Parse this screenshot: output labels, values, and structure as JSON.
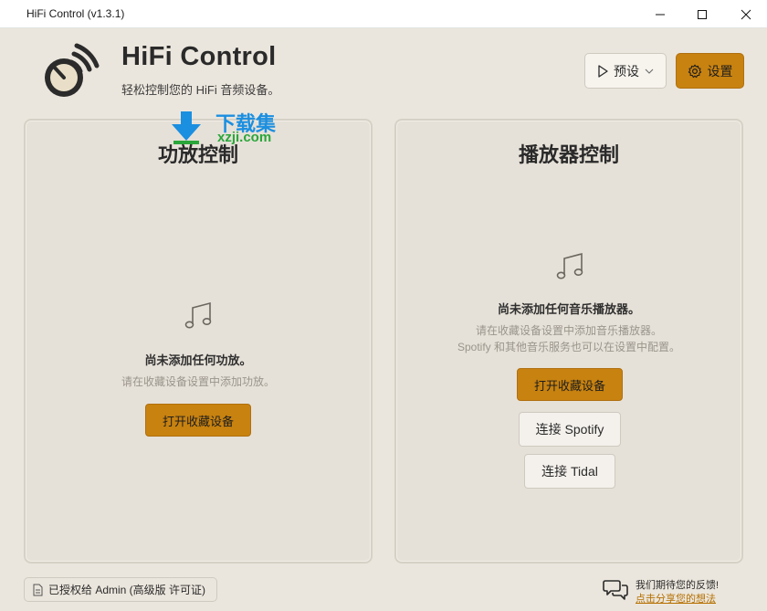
{
  "window": {
    "title": "HiFi Control (v1.3.1)"
  },
  "header": {
    "app_name": "HiFi Control",
    "subtitle": "轻松控制您的 HiFi 音频设备。",
    "preset_label": "预设",
    "settings_label": "设置"
  },
  "watermark": {
    "cn": "下载集",
    "url": "xzji.com"
  },
  "amp_panel": {
    "title": "功放控制",
    "empty_title": "尚未添加任何功放。",
    "empty_desc": "请在收藏设备设置中添加功放。",
    "open_button": "打开收藏设备"
  },
  "player_panel": {
    "title": "播放器控制",
    "empty_title": "尚未添加任何音乐播放器。",
    "empty_desc_1": "请在收藏设备设置中添加音乐播放器。",
    "empty_desc_2": "Spotify 和其他音乐服务也可以在设置中配置。",
    "open_button": "打开收藏设备",
    "spotify_button": "连接 Spotify",
    "tidal_button": "连接 Tidal"
  },
  "footer": {
    "license": "已授权给 Admin (高级版 许可证)",
    "feedback_text": "我们期待您的反馈!",
    "feedback_link": "点击分享您的想法"
  },
  "colors": {
    "accent": "#c8820f",
    "background": "#ebe6dd",
    "panel": "#e6e1d8",
    "link": "#b57000"
  },
  "icons": [
    "app-logo-icon",
    "play-icon",
    "chevron-down-icon",
    "gear-icon",
    "music-note-icon",
    "license-icon",
    "chat-icon",
    "minimize-icon",
    "maximize-icon",
    "close-icon"
  ]
}
